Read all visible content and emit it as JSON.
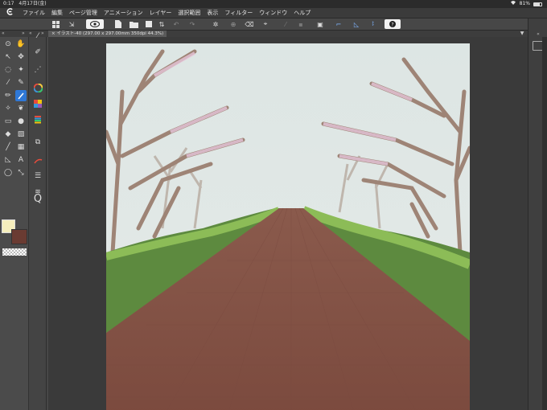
{
  "status_bar": {
    "time": "0:17",
    "date": "4月17日(金)",
    "wifi_icon": "wifi-icon",
    "battery_percent": "81%",
    "battery_level": 0.81
  },
  "menu": {
    "items": [
      "ファイル",
      "編集",
      "ページ管理",
      "アニメーション",
      "レイヤー",
      "選択範囲",
      "表示",
      "フィルター",
      "ウィンドウ",
      "ヘルプ"
    ]
  },
  "document": {
    "tab_title": "イラスト-40 (297.00 x 297.00mm 350dpi 44.3%)"
  },
  "colors": {
    "main_color": "#f6efbd",
    "sub_color": "#6a3b32",
    "accent": "#2f78d6"
  },
  "tools": {
    "left_column": [
      "zoom-icon",
      "move-icon",
      "operation-icon",
      "move-layer-icon",
      "selection-icon",
      "auto-select-icon",
      "eyedropper-icon",
      "pen-icon",
      "pencil-icon",
      "brush-icon",
      "airbrush-icon",
      "decoration-icon",
      "eraser-icon",
      "blend-icon",
      "fill-icon",
      "gradient-icon",
      "figure-icon",
      "frame-icon",
      "ruler-icon",
      "text-icon",
      "balloon-icon",
      "correction-icon"
    ],
    "sub_column": [
      "brush-size-icon",
      "color-wheel-icon",
      "color-set-icon",
      "color-history-icon",
      "layer-property-icon",
      "layer-icon",
      "navigator-icon",
      "search-icon"
    ]
  }
}
